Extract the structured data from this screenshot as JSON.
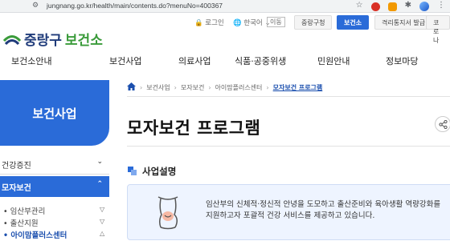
{
  "browser": {
    "url": "jungnang.go.kr/health/main/contents.do?menuNo=400367"
  },
  "util": {
    "login": "로그인",
    "language": "한국어",
    "go_button": "이동",
    "tabs": [
      "중랑구청",
      "보건소",
      "격리통지서 발급",
      "코로나"
    ]
  },
  "logo": {
    "name": "중랑구",
    "sub": "보건소"
  },
  "nav": [
    "보건소안내",
    "보건사업",
    "의료사업",
    "식품·공중위생",
    "민원안내",
    "정보마당"
  ],
  "sidebar": {
    "title": "보건사업",
    "items": [
      "건강증진",
      "모자보건"
    ],
    "subitems": [
      "임산부관리",
      "출산지원",
      "아이맘플러스센터"
    ]
  },
  "breadcrumb": [
    "보건사업",
    "모자보건",
    "아이맘플러스센터",
    "모자보건 프로그램"
  ],
  "page": {
    "title": "모자보건 프로그램",
    "section_title": "사업설명",
    "description_line1": "임산부의 신체적·정신적 안녕을 도모하고 출산준비와 육아생활 역량강화를",
    "description_line2": "지원하고자 포괄적 건강 서비스를 제공하고 있습니다."
  },
  "colors": {
    "primary": "#2a6bd8",
    "logo_blue": "#1f3b7a",
    "logo_green": "#3a9b3a",
    "info_bg": "#eef4ff"
  }
}
